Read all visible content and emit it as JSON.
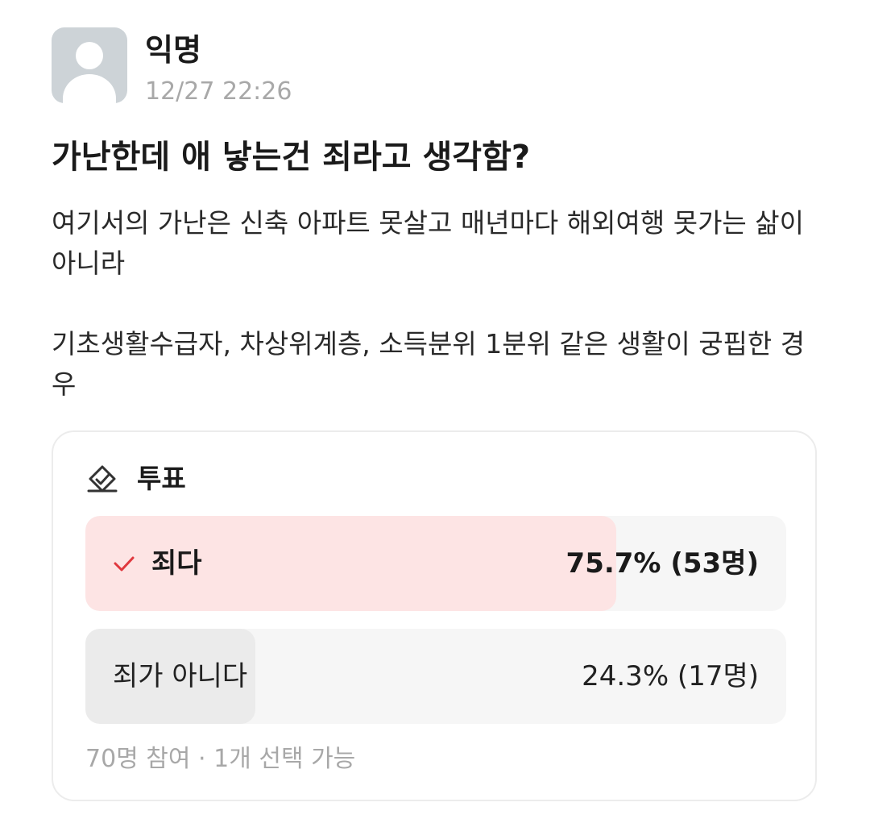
{
  "post": {
    "author": "익명",
    "timestamp": "12/27 22:26",
    "avatar_icon": "default-user-avatar-icon",
    "title": "가난한데 애 낳는건 죄라고 생각함?",
    "body_paragraphs": [
      "여기서의 가난은 신축 아파트 못살고 매년마다 해외여행 못가는 삶이 아니라",
      "기초생활수급자, 차상위계층, 소득분위 1분위 같은 생활이 궁핍한 경우"
    ]
  },
  "poll": {
    "icon": "ballot-box-icon",
    "label": "투표",
    "options": [
      {
        "label": "죄다",
        "result": "75.7% (53명)",
        "fraction": 0.757,
        "selected": true,
        "check_icon": "checkmark-icon"
      },
      {
        "label": "죄가 아니다",
        "result": "24.3% (17명)",
        "fraction": 0.243,
        "selected": false
      }
    ],
    "footer": "70명 참여 · 1개 선택 가능"
  },
  "colors": {
    "selected_fill": "#fde4e4",
    "unselected_fill": "#ebebeb",
    "option_track": "#f6f6f6",
    "check_mark": "#e0383e",
    "muted_text": "#a8a8a8",
    "avatar_bg": "#cdd3d7"
  }
}
